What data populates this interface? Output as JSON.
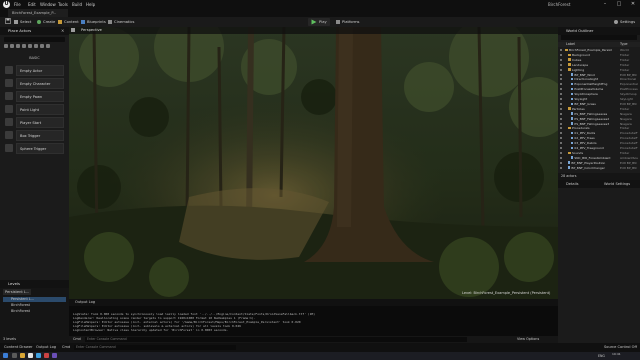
{
  "app": {
    "logo": "U",
    "menu": [
      "File",
      "Edit",
      "Window",
      "Tools",
      "Build",
      "Help"
    ],
    "project_tab": "BirchForest_Example_P...",
    "window_title": "BirchForest",
    "window_controls": [
      "–",
      "□",
      "✕"
    ]
  },
  "toolbar": {
    "save_icon": "save-icon",
    "mode_label": "Select",
    "create_label": "Create",
    "content_label": "Content",
    "blueprints_label": "Blueprints",
    "cinematics_label": "Cinematics",
    "play_label": "Play",
    "platforms_label": "Platforms",
    "settings_label": "Settings"
  },
  "place_actors": {
    "title": "Place Actors",
    "section": "BASIC",
    "items": [
      "Empty Actor",
      "Empty Character",
      "Empty Pawn",
      "Point Light",
      "Player Start",
      "Box Trigger",
      "Sphere Trigger"
    ]
  },
  "levels": {
    "title": "Levels",
    "add_label": "Persistent L...",
    "rows": [
      "Persistent L...",
      "BirchForest",
      "BirchForest"
    ],
    "count": "3 levels"
  },
  "viewport": {
    "tab_label": "Perspective",
    "caption": "Level: BirchForest_Example_Persistent (Persistent)"
  },
  "output_log": {
    "tab_label": "Output Log",
    "filter_label": "Filters",
    "lines": [
      "LogSlate: Took 0.000 seconds to synchronously load lazily loaded font '../../../Engine/Content/Slate/Fonts/DroidSansFallback.ttf' (1M)",
      "LogRenderer: Reallocating scene render targets to support 1920x1080 Format 10 NumSamples 1 (Frame:1).",
      "LogFileHelpers: Editor autosave (incl. external actors) for '/Game/BirchForest/Maps/BirchForest_Example_Persistent' took 0.020",
      "LogFileHelpers: Editor autosave (incl. sublevels & external actors) for all levels took 0.046",
      "LogContentBrowser: Native class hierarchy updated for 'BirchForest' in 0.0003 seconds."
    ],
    "cmd_label": "Cmd",
    "cmd_placeholder": "Enter Console Command",
    "view_options": "View Options"
  },
  "outliner": {
    "title": "World Outliner",
    "search_placeholder": "Search...",
    "col_label": "Label",
    "col_type": "Type",
    "rows": [
      {
        "label": "BirchForest_Example_Persist",
        "type": "World",
        "kind": "folder",
        "indent": 0
      },
      {
        "label": "Background",
        "type": "Folder",
        "kind": "folder",
        "indent": 1
      },
      {
        "label": "Cubes",
        "type": "Folder",
        "kind": "folder",
        "indent": 1
      },
      {
        "label": "Landscape",
        "type": "Folder",
        "kind": "folder",
        "indent": 1
      },
      {
        "label": "Lighting",
        "type": "Folder",
        "kind": "folder",
        "indent": 1
      },
      {
        "label": "BP_BNF_Wind",
        "type": "Edit BP_BN",
        "kind": "actor",
        "indent": 2
      },
      {
        "label": "DirectionalLight",
        "type": "Directional",
        "kind": "actor",
        "indent": 2
      },
      {
        "label": "ExponentialHeightFog",
        "type": "Exponential",
        "kind": "actor",
        "indent": 2
      },
      {
        "label": "PostProcessVolume",
        "type": "PostProcess",
        "kind": "actor",
        "indent": 2
      },
      {
        "label": "SkyAtmosphere",
        "type": "SkyAtmosp",
        "kind": "actor",
        "indent": 2
      },
      {
        "label": "SkyLight",
        "type": "SkyLight",
        "kind": "actor",
        "indent": 2
      },
      {
        "label": "BP_BNF_Grass",
        "type": "Edit BP_BN",
        "kind": "actor",
        "indent": 2
      },
      {
        "label": "Particles",
        "type": "Folder",
        "kind": "folder",
        "indent": 1
      },
      {
        "label": "PS_BNF_FallingLeaves",
        "type": "Niagara",
        "kind": "actor",
        "indent": 2
      },
      {
        "label": "PS_BNF_FallingLeaves2",
        "type": "Niagara",
        "kind": "actor",
        "indent": 2
      },
      {
        "label": "PS_BNF_FallingLeaves3",
        "type": "Niagara",
        "kind": "actor",
        "indent": 2
      },
      {
        "label": "Procedurals",
        "type": "Folder",
        "kind": "folder",
        "indent": 1
      },
      {
        "label": "01_PPV_Roots",
        "type": "ProcedutalF",
        "kind": "actor",
        "indent": 2
      },
      {
        "label": "02_PPV_Trees",
        "type": "ProcedutalF",
        "kind": "actor",
        "indent": 2
      },
      {
        "label": "03_PPV_Debris",
        "type": "ProcedutalF",
        "kind": "actor",
        "indent": 2
      },
      {
        "label": "04_PPV_Treeground",
        "type": "ProcedutalF",
        "kind": "actor",
        "indent": 2
      },
      {
        "label": "Sounds",
        "type": "Folder",
        "kind": "folder",
        "indent": 1
      },
      {
        "label": "SNC_BIR_ForestAmbient",
        "type": "AmbientSou",
        "kind": "actor",
        "indent": 2
      },
      {
        "label": "BP_BNF_PlayerPosition",
        "type": "Edit BP_BN",
        "kind": "actor",
        "indent": 1
      },
      {
        "label": "BP_BNF_ColorChanger",
        "type": "Edit BP_BN",
        "kind": "actor",
        "indent": 1
      }
    ],
    "count": "28 actors"
  },
  "details": {
    "tab_details": "Details",
    "tab_world_settings": "World Settings"
  },
  "statusbar": {
    "content_drawer": "Content Drawer",
    "output_log": "Output Log",
    "cmd": "Cmd",
    "cmd_placeholder": "Enter Console Command",
    "source_control": "Source Control Off"
  },
  "taskbar": {
    "time": "19:41",
    "date": "1/27/2022",
    "lang": "ENG"
  }
}
